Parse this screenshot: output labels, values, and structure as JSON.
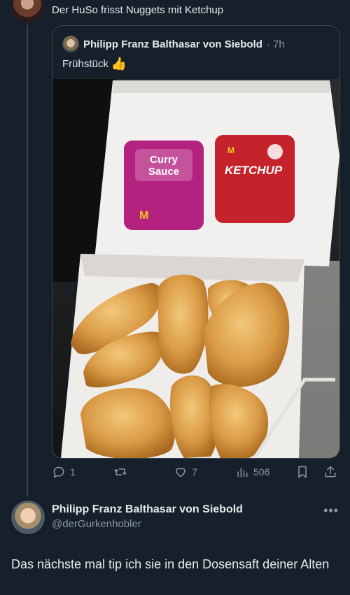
{
  "top": {
    "text": "Der HuSo frisst Nuggets mit Ketchup"
  },
  "quote": {
    "author_name": "Philipp Franz Balthasar von Siebold",
    "time": "· 7h",
    "text": "Frühstück",
    "emoji": "👍",
    "photo": {
      "sauce_left_line1": "Curry",
      "sauce_left_line2": "Sauce",
      "sauce_right": "KETCHUP"
    }
  },
  "actions": {
    "replies": "1",
    "retweets": "",
    "likes": "7",
    "views": "506"
  },
  "reply": {
    "name": "Philipp Franz Balthasar von Siebold",
    "handle": "@derGurkenhobler",
    "text": "Das nächste mal tip ich sie in den Dosensaft deiner Alten",
    "more": "•••"
  },
  "colors": {
    "background": "#15202b",
    "text": "#e7e9ea",
    "muted": "#8b98a5",
    "border": "#38444d"
  }
}
